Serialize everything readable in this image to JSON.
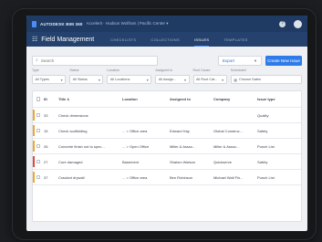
{
  "topbar": {
    "brand": "AUTODESK BIM 360",
    "breadcrumb": "Accelerit · Hudson Wolfram | Pacific Center ▾",
    "help_glyph": "?"
  },
  "navbar": {
    "app_title": "Field Management",
    "tabs": [
      {
        "label": "CHECKLISTS",
        "active": false
      },
      {
        "label": "COLLECTIONS",
        "active": false
      },
      {
        "label": "ISSUES",
        "active": true
      },
      {
        "label": "TEMPLATES",
        "active": false
      }
    ]
  },
  "toolbar": {
    "search_placeholder": "Search",
    "export_label": "Export",
    "create_label": "Create New Issue"
  },
  "filters": [
    {
      "label": "Type",
      "value": "All Types"
    },
    {
      "label": "Status",
      "value": "All Status"
    },
    {
      "label": "Location",
      "value": "All Locations"
    },
    {
      "label": "Assigned to",
      "value": "All Assign..."
    },
    {
      "label": "Root Cause",
      "value": "All Root Cat..."
    },
    {
      "label": "Scheduled",
      "value": "Choose Dates"
    }
  ],
  "table": {
    "headers": {
      "id": "ID",
      "title": "Title ∧",
      "location": "Location",
      "assigned": "Assigned to",
      "company": "Company",
      "type": "Issue type"
    },
    "rows": [
      {
        "priority_color": "#f2a531",
        "id": "33",
        "title": "Check dimensions",
        "location": "",
        "assigned": "",
        "company": "",
        "type": "Quality"
      },
      {
        "priority_color": "#f2a531",
        "id": "15",
        "title": "Check scaffolding",
        "location": "... > Office area",
        "assigned": "Edward Hay",
        "company": "Global Construc...",
        "type": "Safety"
      },
      {
        "priority_color": "#f2a531",
        "id": "26",
        "title": "Concrete finish not to spec...",
        "location": "... > Open Office",
        "assigned": "Miller & Assoc...",
        "company": "Miller & Assoc...",
        "type": "Punch List"
      },
      {
        "priority_color": "#e24a3b",
        "id": "27",
        "title": "Cure damaged",
        "location": "Basement",
        "assigned": "Shalom Watson",
        "company": "Quickserve",
        "type": "Safety"
      },
      {
        "priority_color": "#f2a531",
        "id": "37",
        "title": "Cracked drywall",
        "location": "... > Office area",
        "assigned": "Ben Robinson",
        "company": "Michael Wall Fin...",
        "type": "Punch List"
      }
    ]
  },
  "colors": {
    "topbar_bg": "#1f3b63",
    "navbar_bg": "#24426d",
    "accent": "#2f7be8",
    "priority_medium": "#f2a531",
    "priority_high": "#e24a3b"
  }
}
